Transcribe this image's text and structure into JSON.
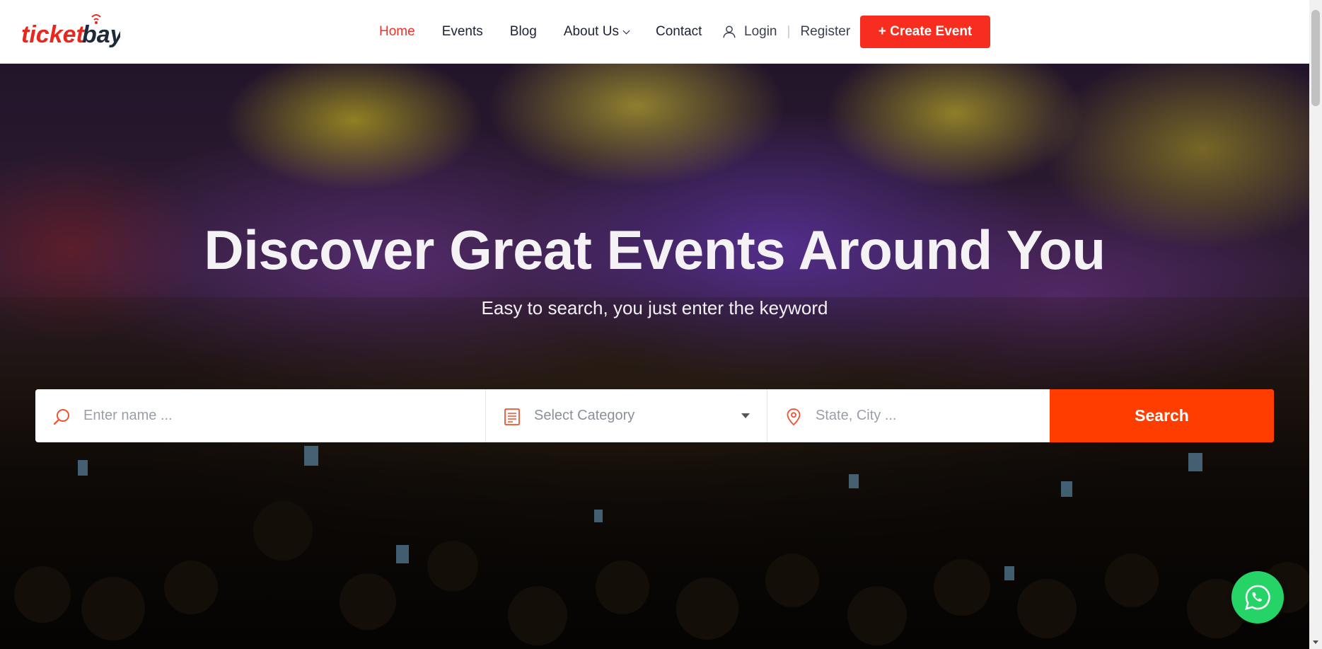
{
  "brand": {
    "logo_text": "ticketbay",
    "accent_color": "#f72d1f"
  },
  "nav": {
    "items": [
      {
        "label": "Home",
        "active": true
      },
      {
        "label": "Events",
        "active": false
      },
      {
        "label": "Blog",
        "active": false
      },
      {
        "label": "About Us",
        "active": false,
        "has_dropdown": true
      },
      {
        "label": "Contact",
        "active": false
      }
    ]
  },
  "auth": {
    "login": "Login",
    "separator": "|",
    "register": "Register"
  },
  "create_event": {
    "label": "+ Create Event"
  },
  "hero": {
    "title": "Discover Great Events Around You",
    "subtitle": "Easy to search, you just enter the keyword"
  },
  "search": {
    "name_placeholder": "Enter name ...",
    "category_placeholder": "Select Category",
    "location_placeholder": "State, City ...",
    "button_label": "Search",
    "button_color": "#ff3d00"
  },
  "icons": {
    "search": "search-icon",
    "category": "document-icon",
    "location": "map-pin-icon",
    "user": "user-icon",
    "whatsapp": "whatsapp-icon"
  }
}
